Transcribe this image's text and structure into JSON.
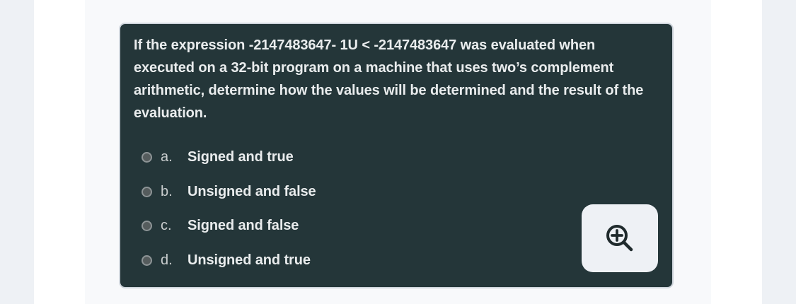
{
  "question": {
    "text": "If the expression -2147483647- 1U < -2147483647 was evaluated when executed on a 32-bit program on a machine that uses two’s complement arithmetic, determine how the values will be determined and the result of the evaluation."
  },
  "options": [
    {
      "letter": "a.",
      "label": "Signed and true"
    },
    {
      "letter": "b.",
      "label": "Unsigned and false"
    },
    {
      "letter": "c.",
      "label": "Signed and false"
    },
    {
      "letter": "d.",
      "label": "Unsigned and true"
    }
  ],
  "zoom_button": {
    "icon": "zoom-in-icon"
  },
  "colors": {
    "card_background": "#243639",
    "card_text": "#e9eced",
    "page_background": "#eef1f5"
  }
}
